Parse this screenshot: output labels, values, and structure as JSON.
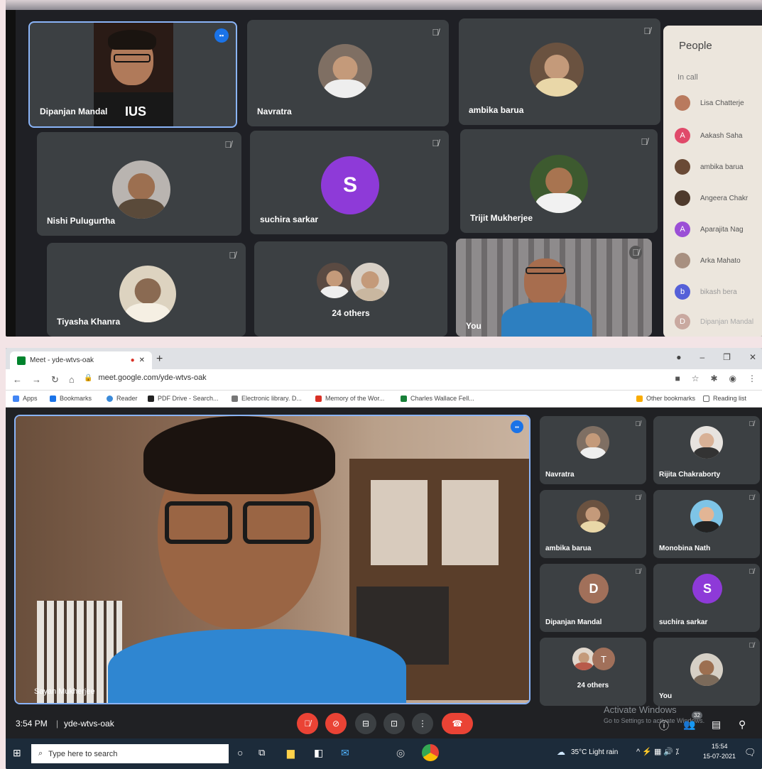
{
  "top_photo": {
    "tiles": [
      {
        "name": "Dipanjan Mandal",
        "has_video": true
      },
      {
        "name": "Navratra"
      },
      {
        "name": "ambika barua"
      },
      {
        "name": "Nishi Pulugurtha"
      },
      {
        "name": "suchira sarkar",
        "avatar_letter": "S"
      },
      {
        "name": "Trijit Mukherjee"
      },
      {
        "name": "Tiyasha Khanra"
      },
      {
        "name": "24 others"
      },
      {
        "name": "You"
      }
    ],
    "people_panel": {
      "title": "People",
      "section": "In call",
      "members": [
        {
          "name": "Lisa Chatterje",
          "letter": ""
        },
        {
          "name": "Aakash Saha",
          "letter": "A"
        },
        {
          "name": "ambika barua",
          "letter": ""
        },
        {
          "name": "Angeera Chakr",
          "letter": ""
        },
        {
          "name": "Aparajita Nag",
          "letter": "A"
        },
        {
          "name": "Arka Mahato",
          "letter": ""
        },
        {
          "name": "bikash bera",
          "letter": "b"
        },
        {
          "name": "Dipanjan Mandal",
          "letter": "D"
        }
      ]
    }
  },
  "browser": {
    "tab_title": "Meet - yde-wtvs-oak",
    "new_tab": "+",
    "window_controls": [
      "–",
      "❐",
      "✕"
    ],
    "url": "meet.google.com/yde-wtvs-oak",
    "bookmarks": [
      "Apps",
      "Bookmarks",
      "Reader",
      "PDF Drive - Search...",
      "Electronic library. D...",
      "Memory of the Wor...",
      "Charles Wallace Fell..."
    ],
    "other_bookmarks": "Other bookmarks",
    "reading_list": "Reading list"
  },
  "meet": {
    "main_speaker": "Sayan Mukherjee",
    "grid": [
      {
        "name": "Navratra"
      },
      {
        "name": "Rijita Chakraborty"
      },
      {
        "name": "ambika barua"
      },
      {
        "name": "Monobina Nath"
      },
      {
        "name": "Dipanjan Mandal",
        "avatar_letter": "D"
      },
      {
        "name": "suchira sarkar",
        "avatar_letter": "S"
      },
      {
        "name": "24 others",
        "avatar_letter": "T"
      },
      {
        "name": "You"
      }
    ],
    "time": "3:54 PM",
    "separator": "|",
    "meeting_code": "yde-wtvs-oak",
    "participant_count": "32",
    "activate_title": "Activate Windows",
    "activate_sub": "Go to Settings to activate Windows."
  },
  "taskbar": {
    "search_placeholder": "Type here to search",
    "weather": "35°C  Light rain",
    "clock_time": "15:54",
    "clock_date": "15-07-2021"
  },
  "colors": {
    "meet_bg": "#202124",
    "tile_bg": "#3c4043",
    "active_border": "#8ab4f8",
    "end_call": "#ea4335",
    "purple_avatar": "#8e3ad8",
    "brown_avatar": "#a1705a"
  }
}
